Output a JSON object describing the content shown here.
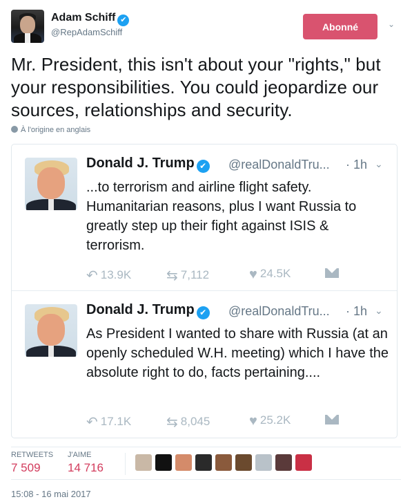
{
  "author": {
    "name": "Adam Schiff",
    "handle": "@RepAdamSchiff",
    "verified_mark": "✔"
  },
  "follow_button": {
    "label": "Abonné"
  },
  "tweet": {
    "text": "Mr. President, this isn't about your \"rights,\" but your responsibilities. You could jeopardize our sources, relationships and security.",
    "translate_label": "À l'origine en anglais"
  },
  "quoted": [
    {
      "name": "Donald J. Trump",
      "handle": "@realDonaldTru...",
      "time": "· 1h",
      "text": "...to terrorism and airline flight safety. Humanitarian reasons, plus I want Russia to greatly step up their fight against ISIS & terrorism.",
      "replies": "13.9K",
      "retweets": "7,112",
      "likes": "24.5K"
    },
    {
      "name": "Donald J. Trump",
      "handle": "@realDonaldTru...",
      "time": "· 1h",
      "text": "As President I wanted to share with Russia (at an openly scheduled W.H. meeting) which I have the absolute right to do, facts pertaining....",
      "replies": "17.1K",
      "retweets": "8,045",
      "likes": "25.2K"
    }
  ],
  "stats": {
    "retweets_label": "RETWEETS",
    "retweets_value": "7 509",
    "likes_label": "J'AIME",
    "likes_value": "14 716"
  },
  "likers": [
    "#c9b8a6",
    "#111111",
    "#d48b6a",
    "#2a2a2a",
    "#8a5a3c",
    "#6b4a2e",
    "#b9c2c9",
    "#5a3a3a",
    "#c93045"
  ],
  "timestamp": "15:08 - 16 mai 2017",
  "icons": {
    "reply": "reply-icon",
    "retweet": "retweet-icon",
    "like": "heart-icon",
    "dm": "envelope-icon",
    "globe": "globe-icon",
    "caret": "chevron-down-icon"
  }
}
